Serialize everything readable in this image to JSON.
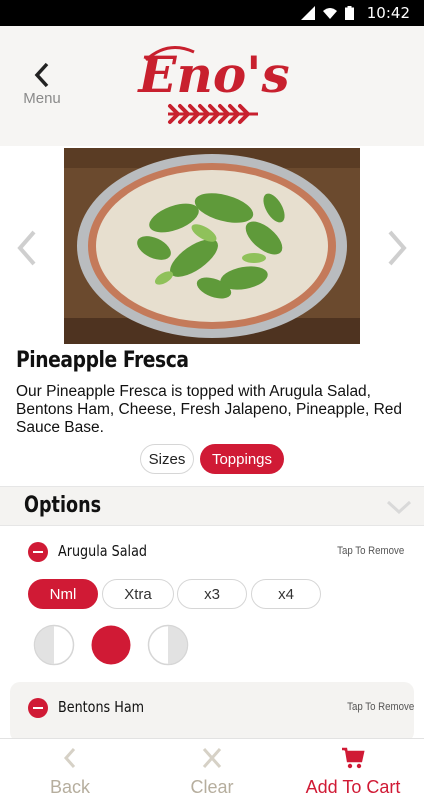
{
  "status_bar": {
    "time": "10:42",
    "icons": [
      "signal-icon",
      "wifi-icon",
      "battery-icon"
    ]
  },
  "header": {
    "back_label": "Menu",
    "logo_text": "Eno's"
  },
  "product": {
    "name": "Pineapple Fresca",
    "description": "Our Pineapple Fresca is topped with Arugula Salad, Bentons Ham, Cheese, Fresh Jalapeno, Pineapple, Red Sauce Base."
  },
  "tabs": {
    "sizes": "Sizes",
    "toppings": "Toppings",
    "selected": "Toppings"
  },
  "options": {
    "title": "Options",
    "toppings": [
      {
        "name": "Arugula Salad",
        "action": "Tap To Remove",
        "amounts": [
          "Nml",
          "Xtra",
          "x3",
          "x4"
        ],
        "selected_amount": "Nml",
        "coverage_options": [
          "left-half",
          "whole",
          "right-half"
        ],
        "selected_coverage": "whole"
      },
      {
        "name": "Bentons Ham",
        "action": "Tap To Remove"
      }
    ]
  },
  "footer": {
    "back": "Back",
    "clear": "Clear",
    "cart": "Add To Cart"
  },
  "colors": {
    "accent": "#d01a35",
    "muted": "#b6ae9e",
    "header_bg": "#f6f5f3",
    "section_bg": "#f4f3f1"
  }
}
